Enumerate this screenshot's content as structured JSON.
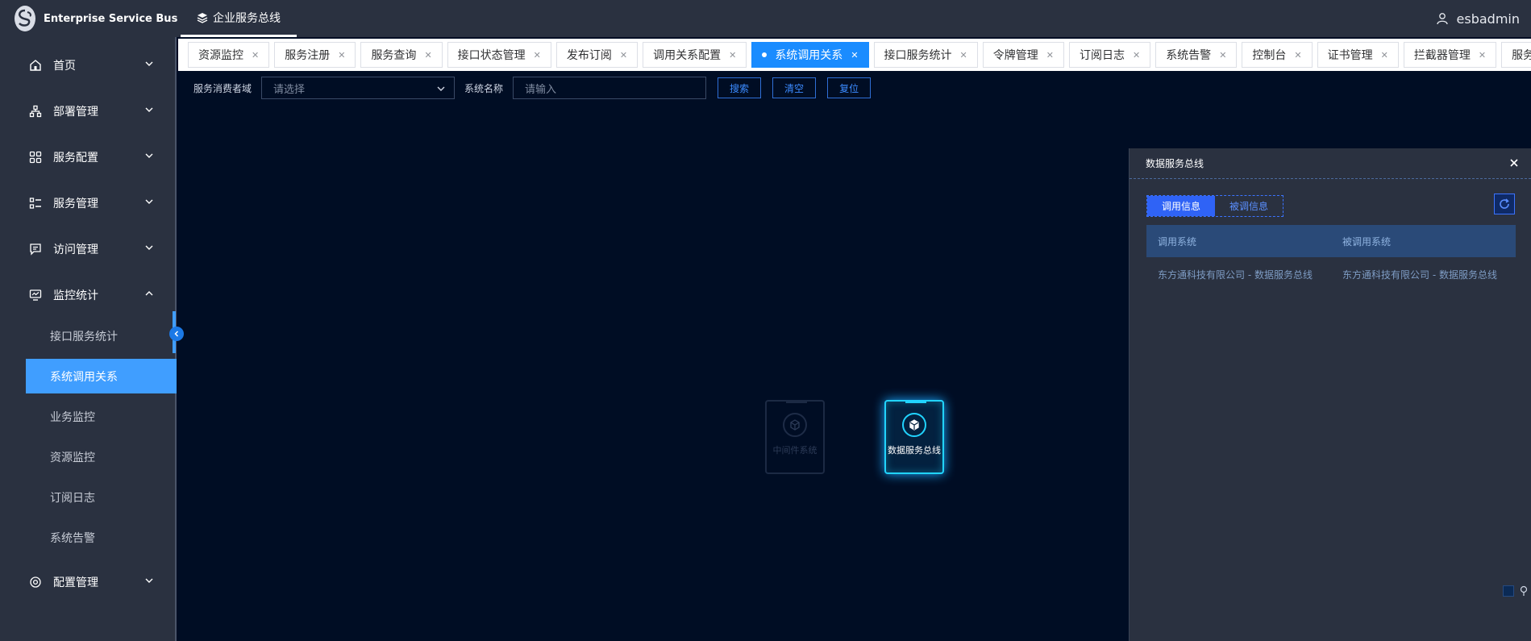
{
  "app": {
    "title": "Enterprise Service Bus",
    "top_tab": "企业服务总线",
    "user": "esbadmin"
  },
  "sidebar": {
    "items": [
      {
        "label": "首页",
        "icon": "home-icon"
      },
      {
        "label": "部署管理",
        "icon": "deploy-icon"
      },
      {
        "label": "服务配置",
        "icon": "grid-icon"
      },
      {
        "label": "服务管理",
        "icon": "list-icon"
      },
      {
        "label": "访问管理",
        "icon": "message-icon"
      },
      {
        "label": "监控统计",
        "icon": "monitor-icon",
        "expanded": true
      },
      {
        "label": "配置管理",
        "icon": "settings-icon"
      }
    ],
    "sub_items": [
      "接口服务统计",
      "系统调用关系",
      "业务监控",
      "资源监控",
      "订阅日志",
      "系统告警"
    ],
    "active_sub": "系统调用关系"
  },
  "tabs": [
    "资源监控",
    "服务注册",
    "服务查询",
    "接口状态管理",
    "发布订阅",
    "调用关系配置",
    "系统调用关系",
    "接口服务统计",
    "令牌管理",
    "订阅日志",
    "系统告警",
    "控制台",
    "证书管理",
    "拦截器管理",
    "服务配置"
  ],
  "active_tab": "系统调用关系",
  "filter": {
    "consumer_label": "服务消费者域",
    "consumer_placeholder": "请选择",
    "system_label": "系统名称",
    "system_placeholder": "请输入",
    "search": "搜索",
    "clear": "清空",
    "reset": "复位"
  },
  "graph": {
    "nodes": [
      {
        "label": "中间件系统",
        "state": "dim"
      },
      {
        "label": "数据服务总线",
        "state": "selected"
      }
    ]
  },
  "panel": {
    "title": "数据服务总线",
    "tabs": [
      "调用信息",
      "被调信息"
    ],
    "active_tab": "调用信息",
    "columns": [
      "调用系统",
      "被调用系统"
    ],
    "rows": [
      [
        "东方通科技有限公司 - 数据服务总线",
        "东方通科技有限公司 - 数据服务总线"
      ]
    ]
  },
  "colors": {
    "accent": "#409eff",
    "background": "#000d24",
    "panel": "#2a3140",
    "node_glow": "#21d4ff"
  }
}
